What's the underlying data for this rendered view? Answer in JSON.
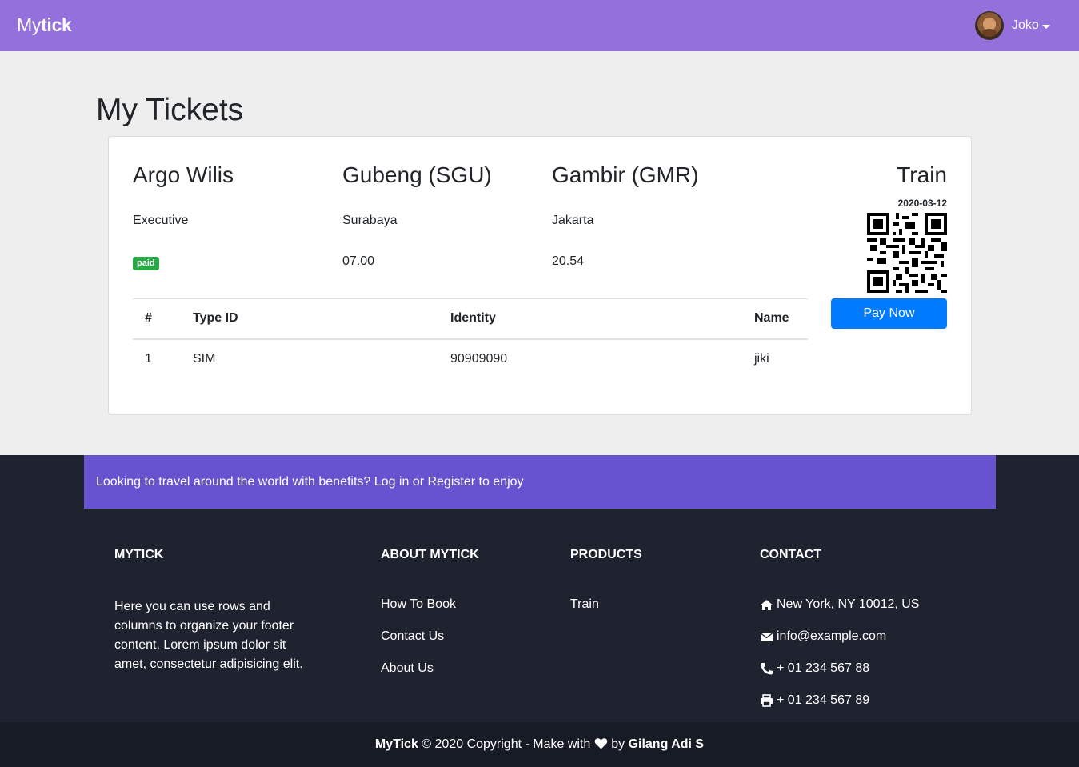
{
  "navbar": {
    "brand_part1": "My",
    "brand_part2": "tick",
    "user_name": "Joko"
  },
  "page_title": "My Tickets",
  "ticket": {
    "train_name": "Argo Wilis",
    "class": "Executive",
    "status": "paid",
    "origin_station": "Gubeng (SGU)",
    "origin_city": "Surabaya",
    "depart_time": "07.00",
    "dest_station": "Gambir (GMR)",
    "dest_city": "Jakarta",
    "arrive_time": "20.54",
    "transport_type": "Train",
    "date": "2020-03-12",
    "pay_label": "Pay Now",
    "table": {
      "headers": [
        "#",
        "Type ID",
        "Identity",
        "Name"
      ],
      "rows": [
        [
          "1",
          "SIM",
          "90909090",
          "jiki"
        ]
      ]
    }
  },
  "footer": {
    "banner_text": "Looking to travel around the world with benefits? Log in or Register to enjoy",
    "col1": {
      "heading": "MYTICK",
      "text": "Here you can use rows and columns to organize your footer content. Lorem ipsum dolor sit amet, consectetur adipisicing elit."
    },
    "col2": {
      "heading": "ABOUT MYTICK",
      "links": [
        "How To Book",
        "Contact Us",
        "About Us"
      ]
    },
    "col3": {
      "heading": "PRODUCTS",
      "links": [
        "Train"
      ]
    },
    "col4": {
      "heading": "CONTACT",
      "address": "New York, NY 10012, US",
      "email": "info@example.com",
      "phone": "+ 01 234 567 88",
      "fax": "+ 01 234 567 89"
    },
    "copyright": {
      "brand": "MyTick",
      "text_mid": "© 2020 Copyright - Make with",
      "text_by": "by",
      "author": "Gilang Adi S"
    }
  },
  "icons": {
    "heart": "heart-icon",
    "home": "home-icon",
    "envelope": "envelope-icon",
    "phone": "phone-icon",
    "print": "print-icon"
  },
  "colors": {
    "navbar": "#9370db",
    "banner": "#6752d0",
    "footer_bg": "#1f2330",
    "paid_badge": "#28a745",
    "pay_button": "#007bff"
  }
}
